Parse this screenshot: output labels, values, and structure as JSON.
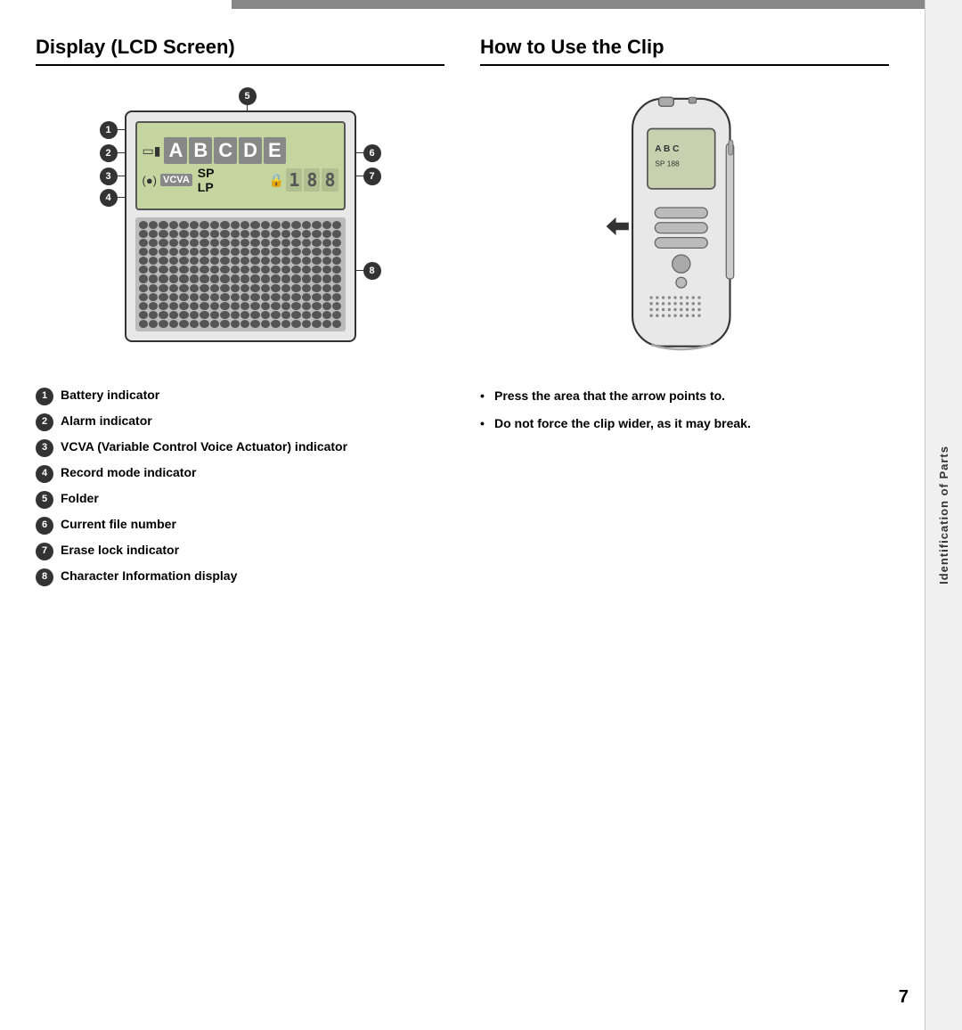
{
  "topBar": {
    "visible": true
  },
  "sidebar": {
    "text": "Identification of Parts"
  },
  "leftSection": {
    "title": "Display (LCD Screen)",
    "diagram": {
      "callouts": [
        {
          "num": "1",
          "label": "Battery indicator"
        },
        {
          "num": "2",
          "label": "Alarm indicator"
        },
        {
          "num": "3",
          "label": "VCVA (Variable Control Voice Actuator) indicator"
        },
        {
          "num": "4",
          "label": "Record mode indicator"
        },
        {
          "num": "5",
          "label": "Folder"
        },
        {
          "num": "6",
          "label": "Current file number"
        },
        {
          "num": "7",
          "label": "Erase lock indicator"
        },
        {
          "num": "8",
          "label": "Character Information display"
        }
      ],
      "lcd": {
        "folders": [
          "A",
          "B",
          "C",
          "D",
          "E"
        ],
        "mode1": "SP",
        "mode2": "LP",
        "fileNumbers": [
          "1",
          "8",
          "8"
        ]
      }
    }
  },
  "rightSection": {
    "title": "How to Use the Clip",
    "bullets": [
      "Press the area that the arrow points to.",
      "Do not force the clip wider, as it may break."
    ]
  },
  "pageNumber": "7"
}
